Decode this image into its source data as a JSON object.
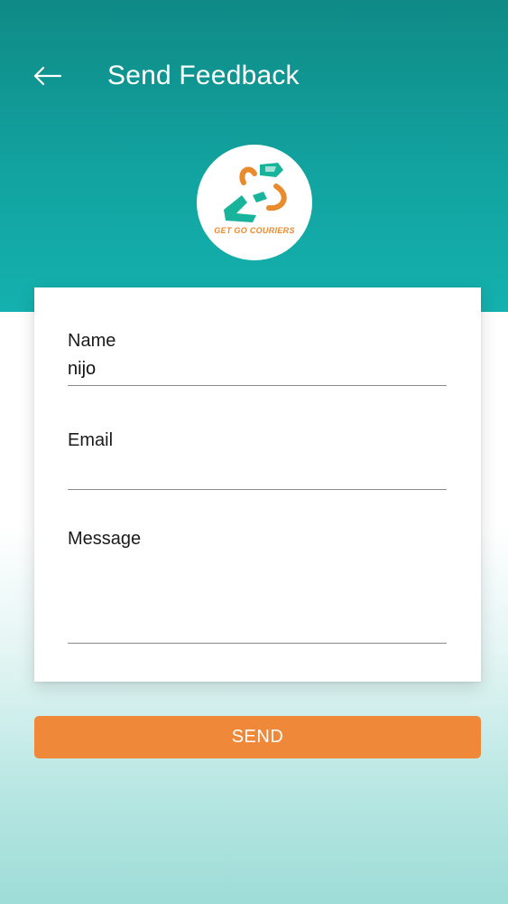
{
  "header": {
    "title": "Send Feedback",
    "back_icon": "arrow-left-icon",
    "background_color": "#12a3a0"
  },
  "logo": {
    "text": "GET GO COURIERS",
    "accent_color": "#e98a2c",
    "secondary_color": "#18b39b"
  },
  "form": {
    "name": {
      "label": "Name",
      "value": "nijo",
      "placeholder": ""
    },
    "email": {
      "label": "Email",
      "value": "",
      "placeholder": ""
    },
    "message": {
      "label": "Message",
      "value": "",
      "placeholder": ""
    }
  },
  "send_button": {
    "label": "SEND",
    "color": "#ef8838"
  }
}
